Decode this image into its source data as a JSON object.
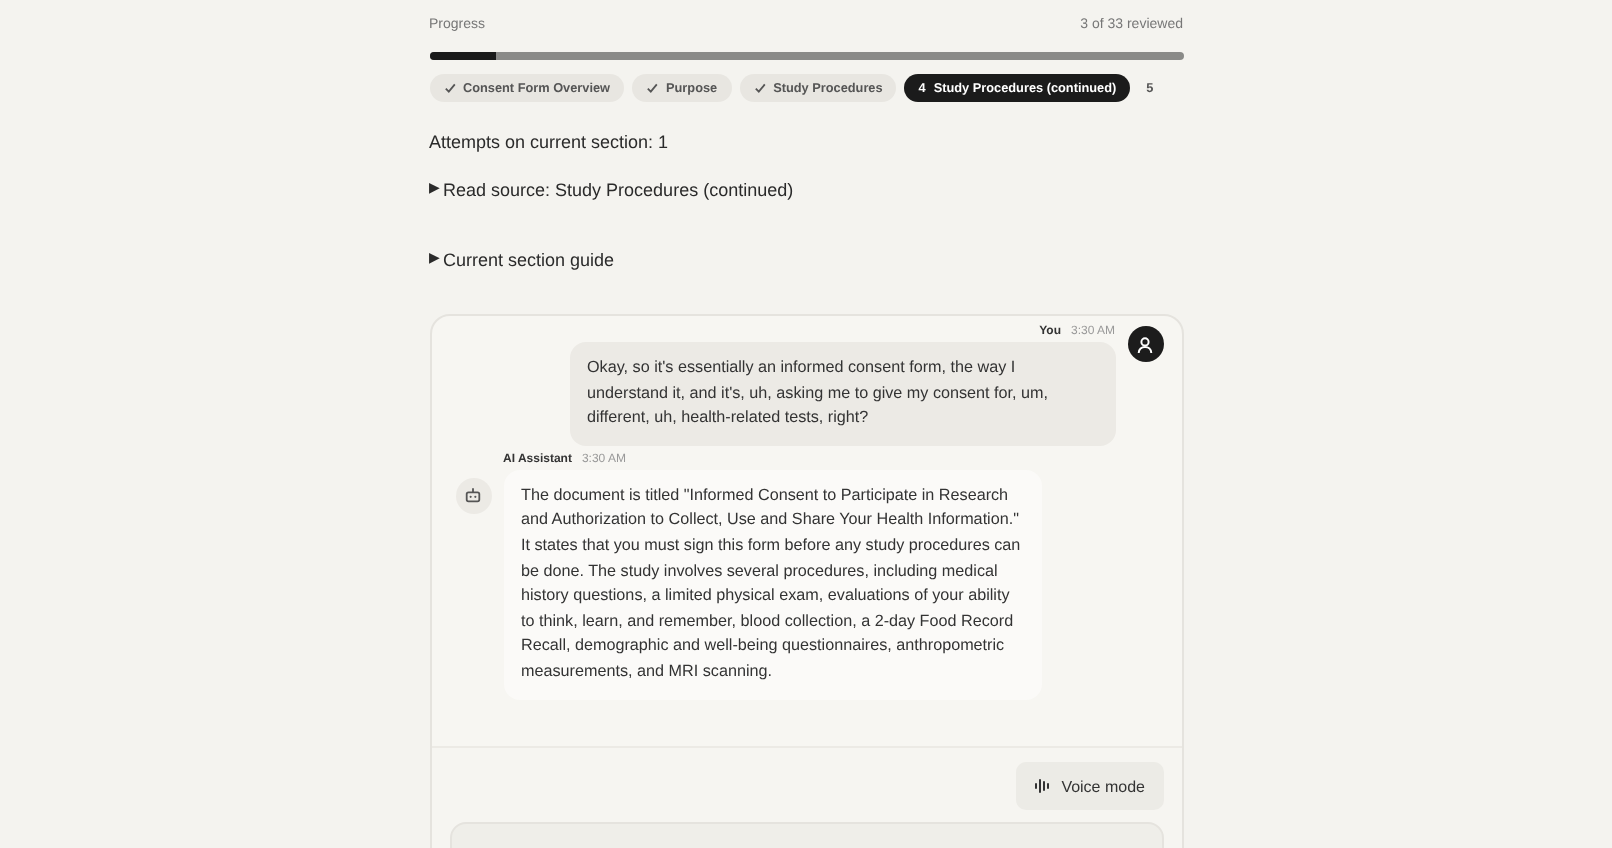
{
  "progress": {
    "label": "Progress",
    "reading": "3 of 33 reviewed",
    "level": 0.09
  },
  "sections": [
    {
      "label": "Consent Form Overview",
      "kind": "done",
      "selected": false
    },
    {
      "label": "Purpose",
      "kind": "done",
      "selected": false
    },
    {
      "label": "Study Procedures",
      "kind": "done",
      "selected": false
    },
    {
      "number": "4",
      "label": "Study Procedures (continued)",
      "kind": "current",
      "selected": true
    },
    {
      "number": "5",
      "kind": "upcoming",
      "selected": false
    }
  ],
  "attempts": "Attempts on current section: 1",
  "disclosures": [
    {
      "marker": "▶",
      "label": "Read source: Study Procedures (continued)",
      "expanded": false
    },
    {
      "marker": "▶",
      "label": "Current section guide",
      "expanded": false
    }
  ],
  "messages": [
    {
      "kind": "user",
      "author": "You",
      "time": "3:30 AM",
      "text": "Okay, so it's essentially an informed consent form, the way I understand it, and it's, uh, asking me to give my consent for, um, different, uh, health-related tests, right?"
    },
    {
      "kind": "assistant",
      "author": "AI Assistant",
      "time": "3:30 AM",
      "text": "The document is titled \"Informed Consent to Participate in Research and Authorization to Collect, Use and Share Your Health Information.\" It states that you must sign this form before any study procedures can be done. The study involves several procedures, including medical history questions, a limited physical exam, evaluations of your ability to think, learn, and remember, blood collection, a 2-day Food Record Recall, demographic and well-being questionnaires, anthropometric measurements, and MRI scanning."
    }
  ],
  "voice_button": "Voice mode"
}
